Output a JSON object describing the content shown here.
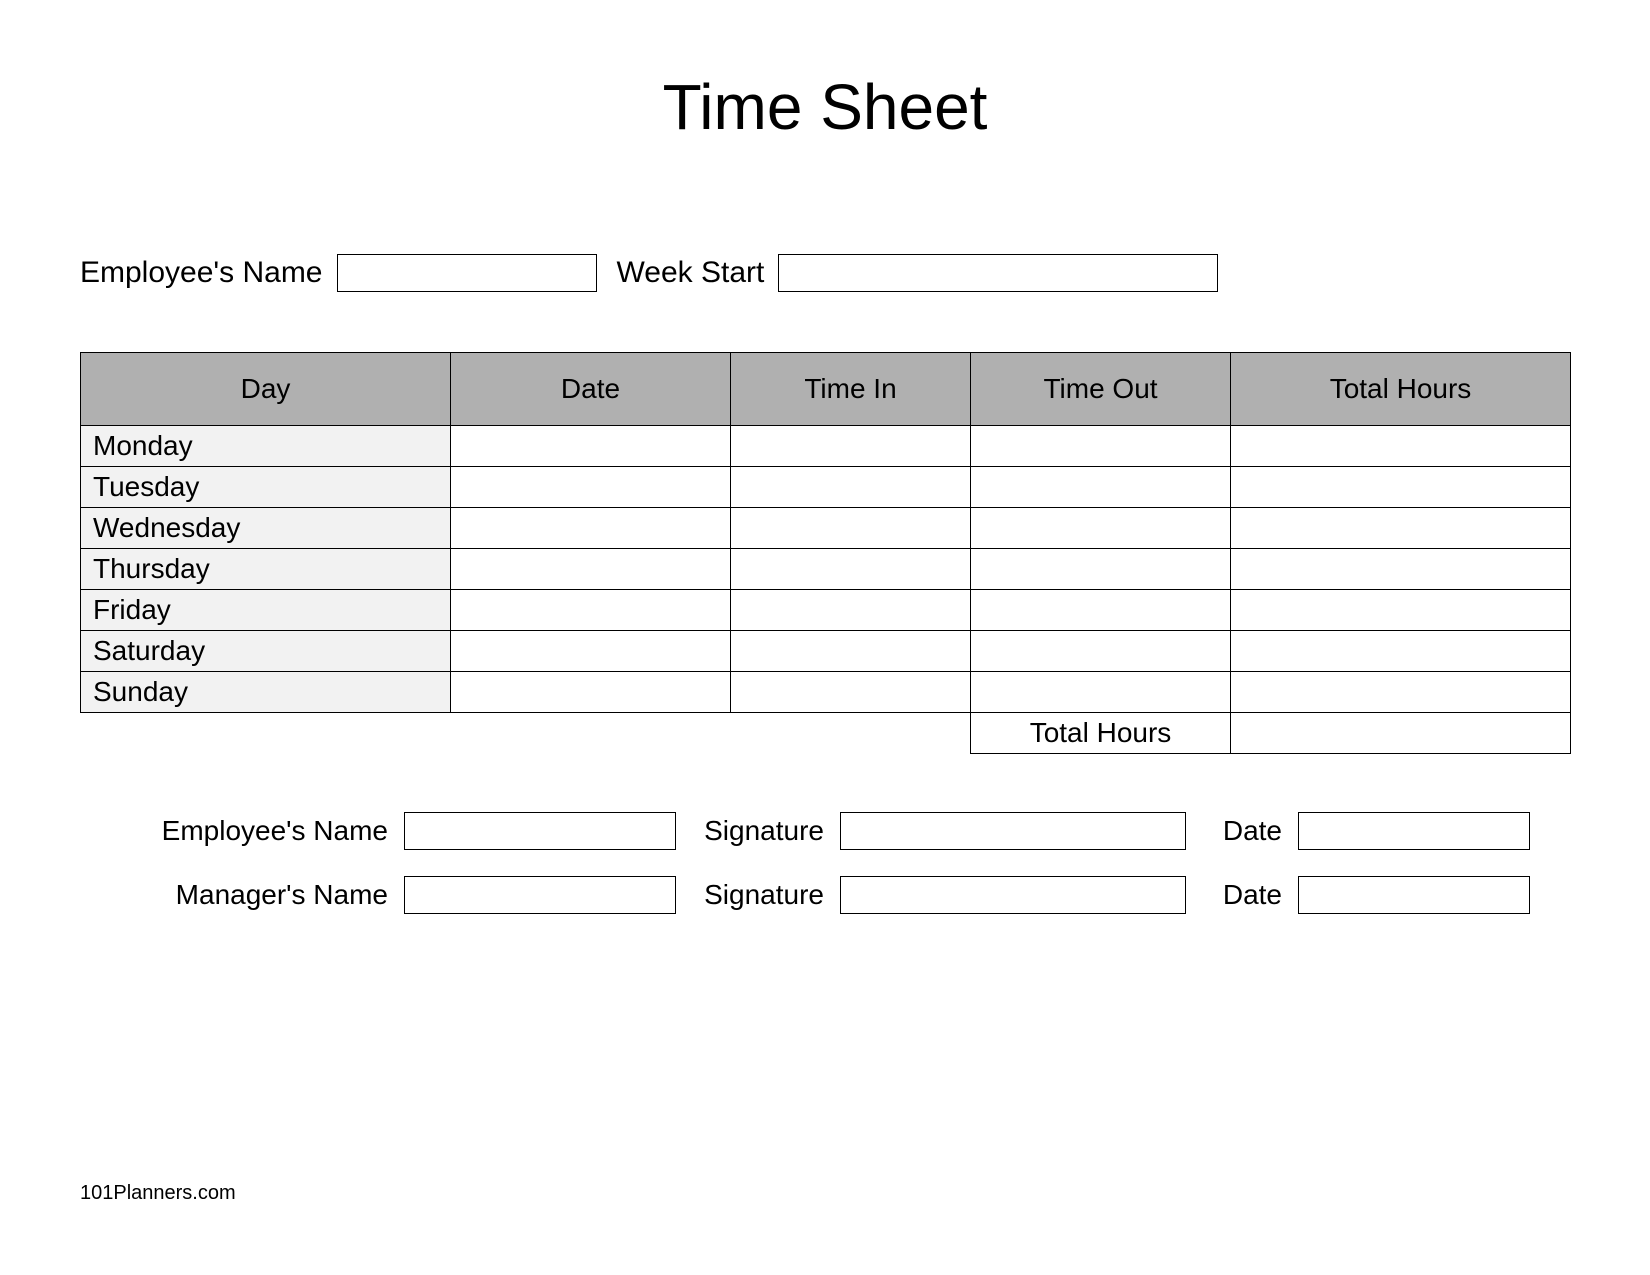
{
  "title": "Time Sheet",
  "top": {
    "employee_name_label": "Employee's Name",
    "week_start_label": "Week Start"
  },
  "table": {
    "headers": {
      "day": "Day",
      "date": "Date",
      "time_in": "Time In",
      "time_out": "Time Out",
      "total_hours": "Total Hours"
    },
    "days": [
      "Monday",
      "Tuesday",
      "Wednesday",
      "Thursday",
      "Friday",
      "Saturday",
      "Sunday"
    ],
    "total_label": "Total Hours"
  },
  "sign": {
    "employee_name_label": "Employee's Name",
    "manager_name_label": "Manager's Name",
    "signature_label": "Signature",
    "date_label": "Date"
  },
  "footer": "101Planners.com"
}
